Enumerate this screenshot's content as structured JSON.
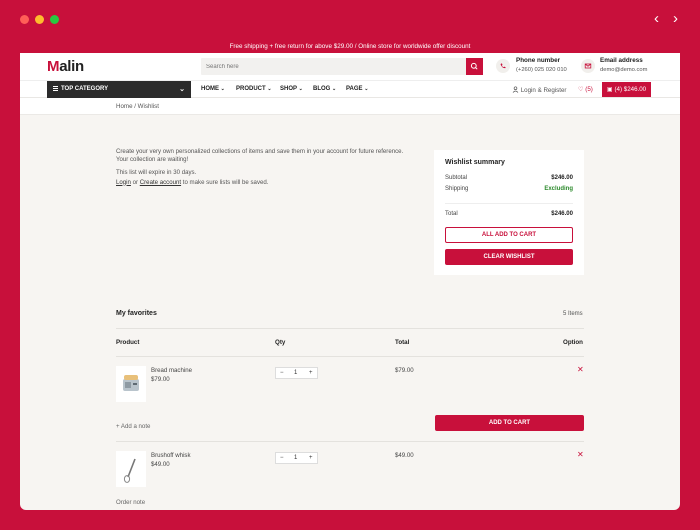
{
  "browser": {
    "back_glyph": "‹",
    "forward_glyph": "›"
  },
  "topbar": {
    "text": "Free shipping + free return for above $29.00   /   Online store for worldwide offer discount"
  },
  "header": {
    "logo_initial": "M",
    "logo_rest": "alin",
    "search_placeholder": "Search here",
    "phone": {
      "title": "Phone number",
      "value": "(+260) 025 020 010"
    },
    "email": {
      "title": "Email address",
      "value": "demo@demo.com"
    }
  },
  "navbar": {
    "top_category": "TOP CATEGORY",
    "menu": [
      "HOME",
      "PRODUCT",
      "SHOP",
      "BLOG",
      "PAGE"
    ],
    "login": "Login & Register",
    "wishlist_count": "(5)",
    "cart": "(4) $246.00"
  },
  "breadcrumb": "Home / Wishlist",
  "intro": {
    "line1": "Create your very own personalized collections of items and save them in your account for future reference.",
    "line2": "Your collection are waiting!",
    "expire": "This list will expire in 30 days.",
    "login_link": "Login",
    "or": "or",
    "create_link": "Create account",
    "suffix": "to make sure lists will be saved."
  },
  "summary": {
    "title": "Wishlist summary",
    "subtotal_label": "Subtotal",
    "subtotal_value": "$246.00",
    "shipping_label": "Shipping",
    "shipping_value": "Excluding",
    "total_label": "Total",
    "total_value": "$246.00",
    "add_all": "ALL ADD TO CART",
    "clear": "CLEAR WISHLIST"
  },
  "favorites": {
    "title": "My favorites",
    "count": "5 Items",
    "columns": [
      "Product",
      "Qty",
      "Total",
      "Option"
    ],
    "items": [
      {
        "name": "Bread machine",
        "price": "$79.00",
        "qty": "1",
        "total": "$79.00"
      },
      {
        "name": "Brushoff whisk",
        "price": "$49.00",
        "qty": "1",
        "total": "$49.00"
      }
    ],
    "add_note": "Add a note",
    "add_to_cart": "ADD TO CART",
    "order_note": "Order note"
  }
}
